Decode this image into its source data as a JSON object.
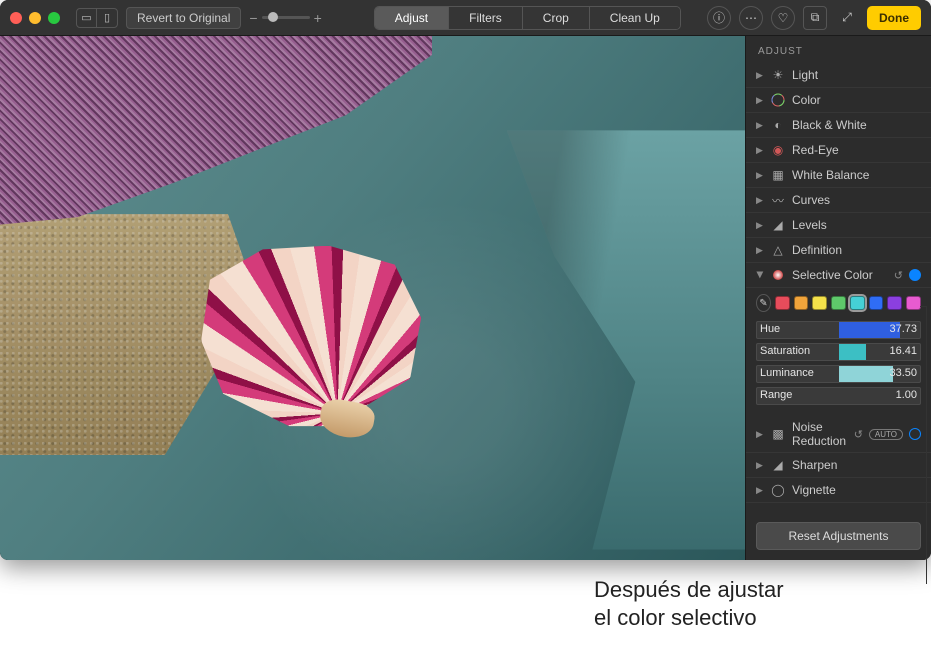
{
  "toolbar": {
    "revert_label": "Revert to Original",
    "tabs": [
      "Adjust",
      "Filters",
      "Crop",
      "Clean Up"
    ],
    "active_tab": 0,
    "done_label": "Done"
  },
  "panel": {
    "header": "ADJUST",
    "sections": [
      {
        "icon": "light-icon",
        "label": "Light"
      },
      {
        "icon": "color-icon",
        "label": "Color"
      },
      {
        "icon": "bw-icon",
        "label": "Black & White"
      },
      {
        "icon": "redeye-icon",
        "label": "Red-Eye"
      },
      {
        "icon": "wb-icon",
        "label": "White Balance"
      },
      {
        "icon": "curves-icon",
        "label": "Curves"
      },
      {
        "icon": "levels-icon",
        "label": "Levels"
      },
      {
        "icon": "definition-icon",
        "label": "Definition"
      }
    ],
    "selective": {
      "label": "Selective Color",
      "swatches": [
        "#e74c5b",
        "#f0a43b",
        "#f4e14a",
        "#5ec96a",
        "#45d0d6",
        "#2f6df6",
        "#8b3fe0",
        "#e85bd0"
      ],
      "selected_swatch": 4,
      "sliders": [
        {
          "name": "Hue",
          "value": 37.73,
          "fill_start": 0.5,
          "fill_end": 0.88,
          "color": "#2f5fe0"
        },
        {
          "name": "Saturation",
          "value": 16.41,
          "fill_start": 0.5,
          "fill_end": 0.67,
          "color": "#3cbfc4"
        },
        {
          "name": "Luminance",
          "value": 33.5,
          "fill_start": 0.5,
          "fill_end": 0.835,
          "color": "#8fd4d8"
        },
        {
          "name": "Range",
          "value": 1.0,
          "fill_start": 0.0,
          "fill_end": 0.0,
          "color": "#555"
        }
      ]
    },
    "after": [
      {
        "icon": "noise-icon",
        "label": "Noise Reduction",
        "auto": true,
        "dot": false
      },
      {
        "icon": "sharpen-icon",
        "label": "Sharpen"
      },
      {
        "icon": "vignette-icon",
        "label": "Vignette"
      }
    ],
    "reset_label": "Reset Adjustments"
  },
  "annotation": {
    "line1": "Después de ajustar",
    "line2": "el color selectivo"
  }
}
